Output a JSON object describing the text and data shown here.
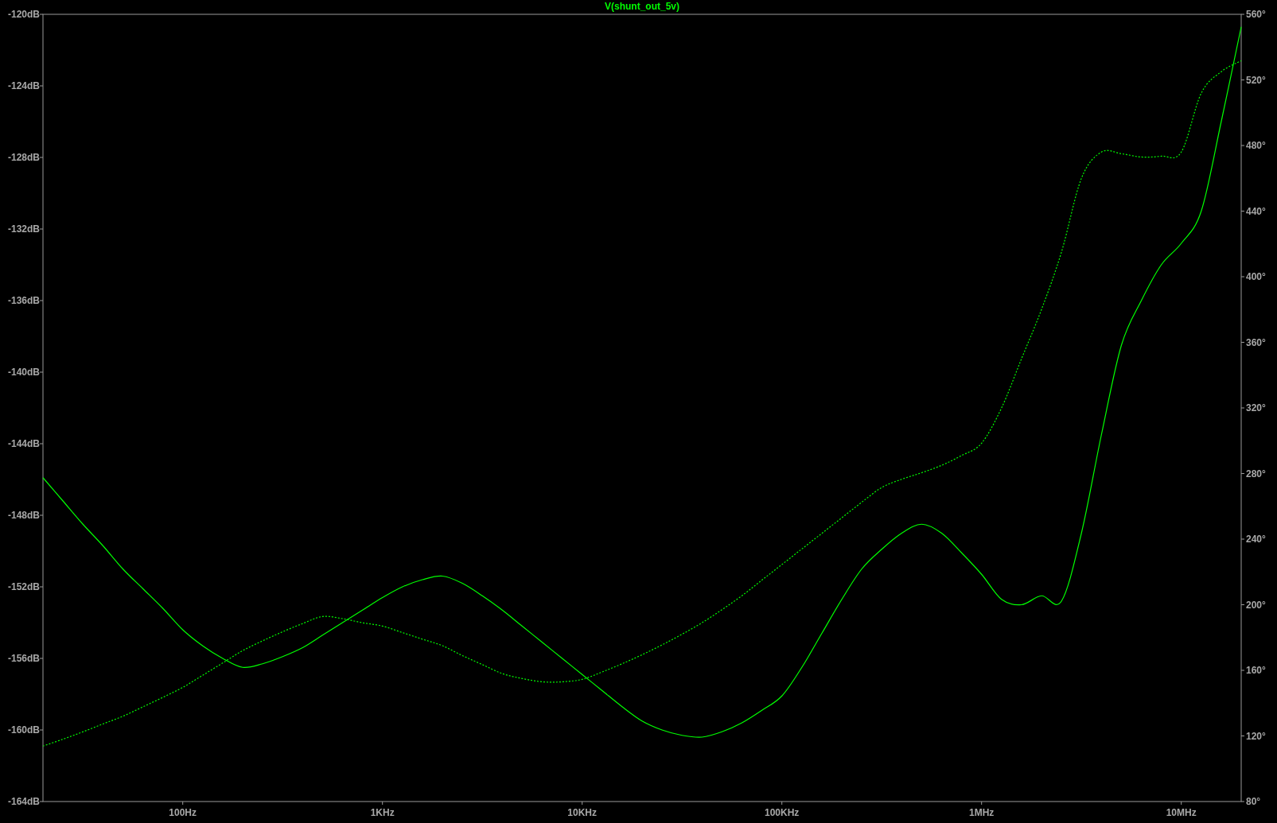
{
  "plot": {
    "chart_data": {
      "type": "line",
      "title": "V(shunt_out_5v)",
      "ylim": [
        -164,
        -120
      ],
      "y2lim": [
        80,
        560
      ],
      "categories": [
        null,
        null,
        null,
        null,
        null,
        null,
        null,
        "100Hz",
        null,
        null,
        null,
        null,
        null,
        null,
        null,
        null,
        null,
        "1KHz",
        null,
        null,
        null,
        null,
        null,
        null,
        null,
        null,
        null,
        "10KHz",
        null,
        null,
        null,
        null,
        null,
        null,
        null,
        null,
        null,
        "100KHz",
        null,
        null,
        null,
        null,
        null,
        null,
        null,
        null,
        null,
        "1MHz",
        null,
        null,
        null,
        null,
        null,
        null,
        null,
        null,
        null,
        "10MHz",
        null,
        null,
        null
      ],
      "yticks": [
        {
          "value": -120,
          "label": "-120dB"
        },
        {
          "value": -124,
          "label": "-124dB"
        },
        {
          "value": -128,
          "label": "-128dB"
        },
        {
          "value": -132,
          "label": "-132dB"
        },
        {
          "value": -136,
          "label": "-136dB"
        },
        {
          "value": -140,
          "label": "-140dB"
        },
        {
          "value": -144,
          "label": "-144dB"
        },
        {
          "value": -148,
          "label": "-148dB"
        },
        {
          "value": -152,
          "label": "-152dB"
        },
        {
          "value": -156,
          "label": "-156dB"
        },
        {
          "value": -160,
          "label": "-160dB"
        },
        {
          "value": -164,
          "label": "-164dB"
        }
      ],
      "y2ticks": [
        {
          "value": 560,
          "label": "560°"
        },
        {
          "value": 520,
          "label": "520°"
        },
        {
          "value": 480,
          "label": "480°"
        },
        {
          "value": 440,
          "label": "440°"
        },
        {
          "value": 400,
          "label": "400°"
        },
        {
          "value": 360,
          "label": "360°"
        },
        {
          "value": 320,
          "label": "320°"
        },
        {
          "value": 280,
          "label": "280°"
        },
        {
          "value": 240,
          "label": "240°"
        },
        {
          "value": 200,
          "label": "200°"
        },
        {
          "value": 160,
          "label": "160°"
        },
        {
          "value": 120,
          "label": "120°"
        },
        {
          "value": 80,
          "label": "80°"
        }
      ],
      "series": [
        {
          "color": "#00ff00",
          "line_style": "solid",
          "values": [
            -145.9,
            -147.2,
            -148.5,
            -149.7,
            -151.0,
            -152.1,
            -153.2,
            -154.4,
            -155.3,
            -156.0,
            -156.5,
            -156.3,
            -155.9,
            -155.4,
            -154.7,
            -154.0,
            -153.3,
            -152.6,
            -152.0,
            -151.6,
            -151.4,
            -151.8,
            -152.5,
            -153.3,
            -154.2,
            -155.1,
            -156.0,
            -156.9,
            -157.8,
            -158.7,
            -159.5,
            -160.0,
            -160.3,
            -160.4,
            -160.1,
            -159.6,
            -158.9,
            -158.1,
            -156.5,
            -154.6,
            -152.7,
            -151.0,
            -149.9,
            -149.0,
            -148.5,
            -149.0,
            -150.1,
            -151.3,
            -152.7,
            -153.0,
            -152.5,
            -152.8,
            -149.0,
            -143.5,
            -138.5,
            -136.0,
            -134.0,
            -132.8,
            -131.0,
            -126.0,
            -120.7
          ]
        },
        {
          "color": "#00ff00",
          "axis": "y2",
          "line_style": "dashed",
          "values": [
            113.8,
            118,
            122.5,
            127.3,
            132,
            137.7,
            143.5,
            149.6,
            157,
            164.5,
            172,
            178,
            183.5,
            188.5,
            192.8,
            191.5,
            189,
            187,
            183,
            179,
            175,
            169,
            163.5,
            158,
            155,
            153,
            153,
            154.5,
            159,
            164,
            169.5,
            175.5,
            182,
            189,
            197,
            205.5,
            215,
            224.5,
            234,
            243.5,
            253,
            262.5,
            271.5,
            276.5,
            280.5,
            285,
            291,
            298.5,
            320,
            350,
            380,
            415,
            460,
            476,
            475,
            473,
            473.5,
            476,
            511.9,
            525,
            531.7
          ]
        }
      ]
    }
  }
}
